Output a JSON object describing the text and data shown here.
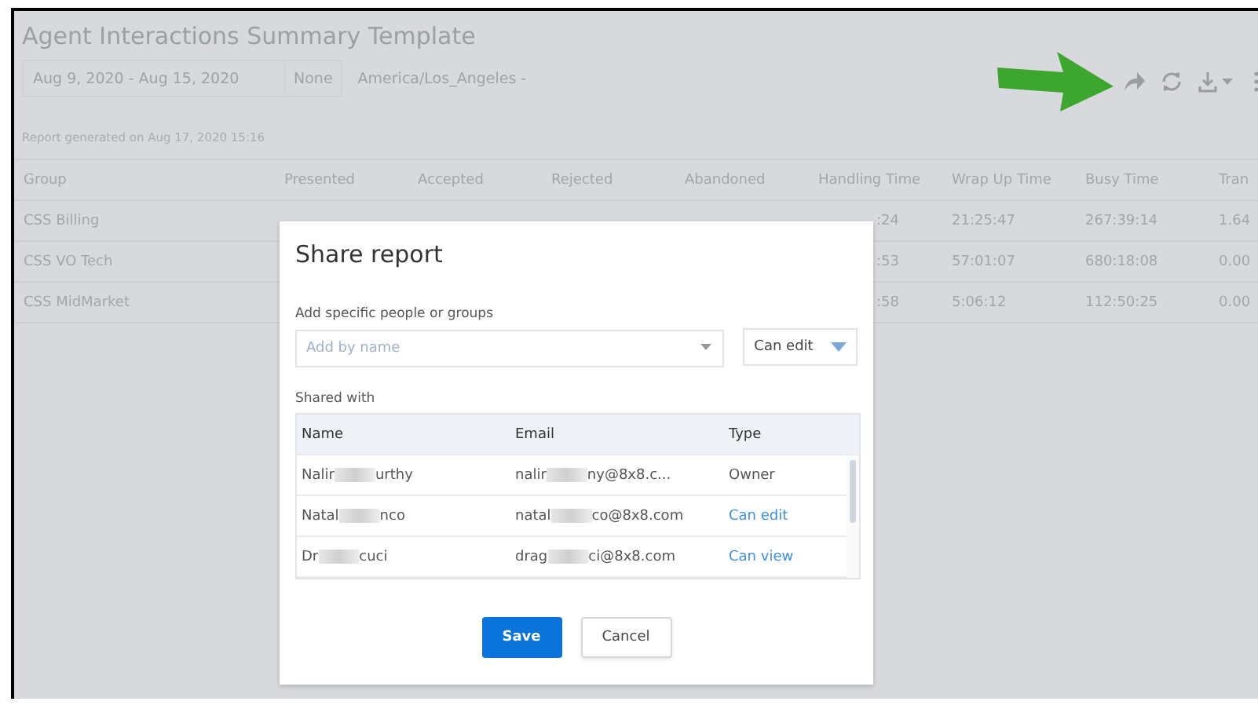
{
  "report": {
    "title": "Agent Interactions Summary Template",
    "date_range": "Aug 9, 2020 - Aug 15, 2020",
    "compare": "None",
    "timezone": "America/Los_Angeles -",
    "generated": "Report generated on Aug 17, 2020 15:16"
  },
  "table": {
    "columns": [
      "Group",
      "Presented",
      "Accepted",
      "Rejected",
      "Abandoned",
      "Handling Time",
      "Wrap Up Time",
      "Busy Time",
      "Tran"
    ],
    "rows": [
      {
        "group": "CSS Billing",
        "handling": ":24",
        "wrap": "21:25:47",
        "busy": "267:39:14",
        "column_9": "1.64"
      },
      {
        "group": "CSS VO Tech",
        "handling": ":53",
        "wrap": "57:01:07",
        "busy": "680:18:08",
        "column_9": "0.00"
      },
      {
        "group": "CSS MidMarket",
        "handling": ":58",
        "wrap": "5:06:12",
        "busy": "112:50:25",
        "column_9": "0.00"
      }
    ]
  },
  "dialog": {
    "title": "Share report",
    "add_label": "Add specific people or groups",
    "add_placeholder": "Add by name",
    "permission": "Can edit",
    "shared_label": "Shared with",
    "columns": [
      "Name",
      "Email",
      "Type"
    ],
    "people": [
      {
        "name_start": "Nalir",
        "name_end": "urthy",
        "email_start": "nalir",
        "email_end": "ny@8x8.c...",
        "type": "Owner",
        "kind": "owner"
      },
      {
        "name_start": "Natal",
        "name_end": "nco",
        "email_start": "natal",
        "email_end": "co@8x8.com",
        "type": "Can edit",
        "kind": "link"
      },
      {
        "name_start": "Dr",
        "name_end": "cuci",
        "email_start": "drag",
        "email_end": "ci@8x8.com",
        "type": "Can view",
        "kind": "link"
      }
    ],
    "buttons": [
      {
        "label": "Save",
        "kind": "primary"
      },
      {
        "label": "Cancel",
        "kind": "secondary"
      }
    ]
  }
}
